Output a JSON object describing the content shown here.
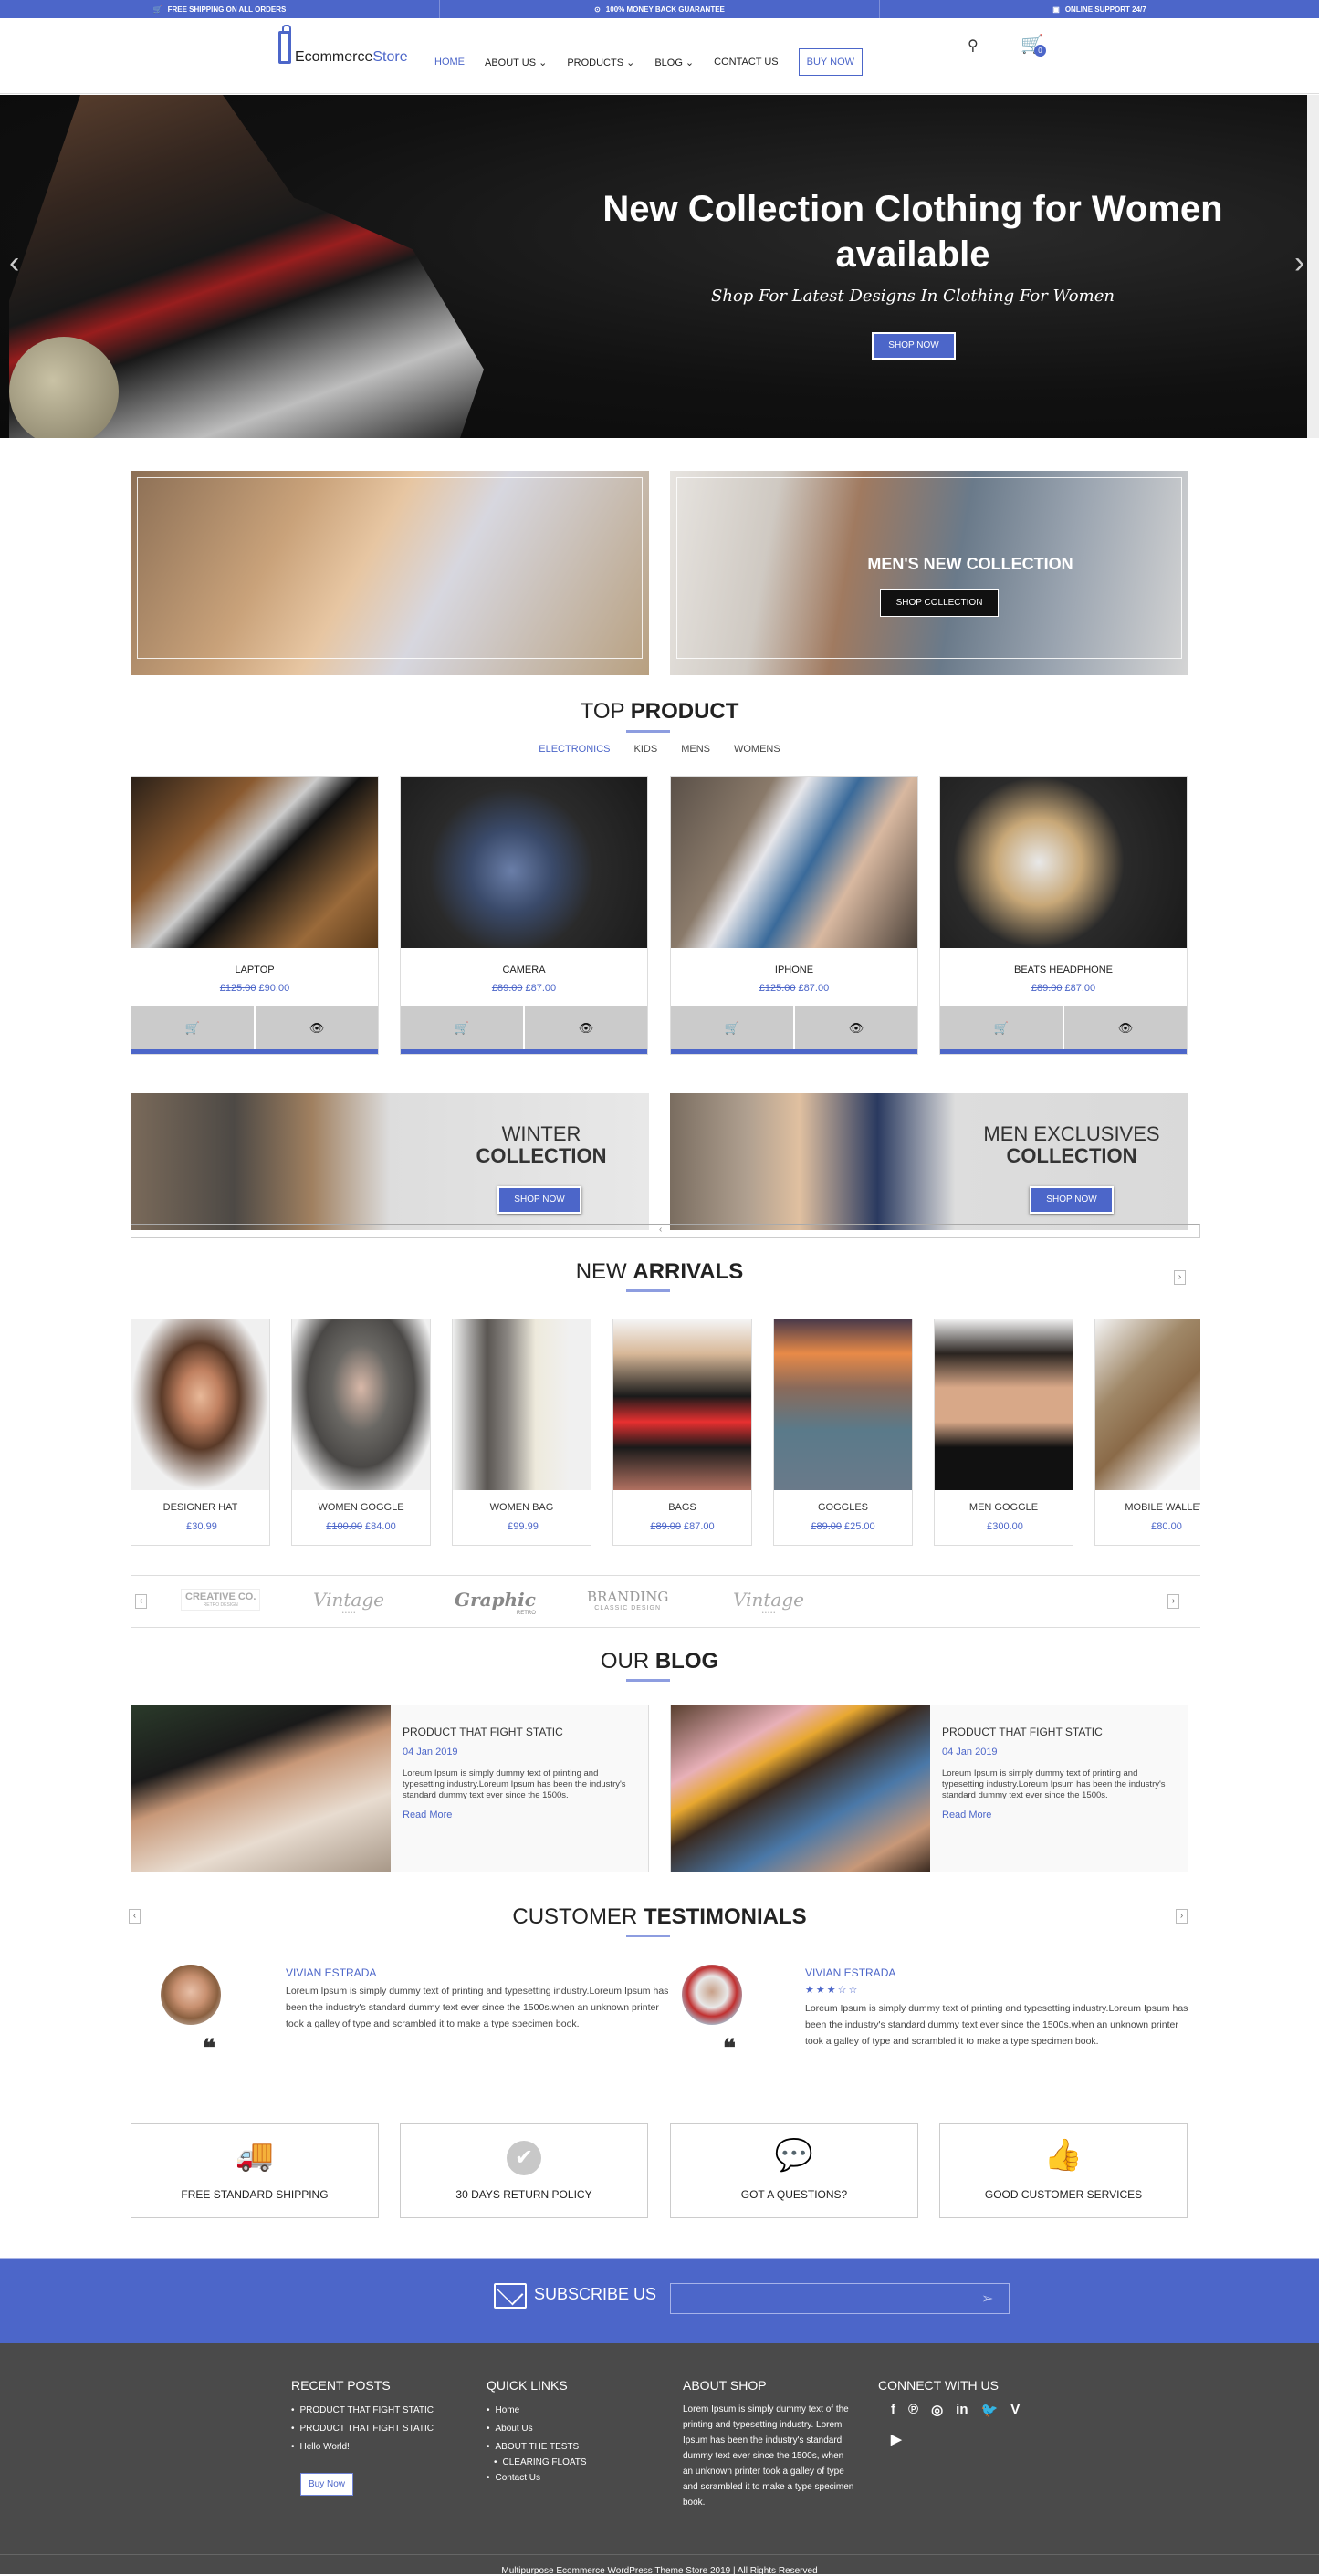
{
  "topbar": {
    "items": [
      {
        "icon": "cart-icon",
        "glyph": "🛒",
        "label": "FREE SHIPPING ON ALL ORDERS"
      },
      {
        "icon": "money-icon",
        "glyph": "⊙",
        "label": "100% MONEY BACK GUARANTEE"
      },
      {
        "icon": "support-icon",
        "glyph": "▣",
        "label": "ONLINE SUPPORT 24/7"
      }
    ]
  },
  "header": {
    "logo_text_1": "Ecommerce",
    "logo_text_2": "Store",
    "nav": {
      "home": "HOME",
      "about": "ABOUT US ⌄",
      "products": "PRODUCTS ⌄",
      "blog": "BLOG ⌄",
      "contact": "CONTACT US",
      "buy": "BUY NOW"
    },
    "cart_count": "0"
  },
  "hero": {
    "title": "New Collection Clothing for Women available",
    "subtitle": "Shop For Latest Designs In Clothing For Women",
    "button": "SHOP NOW",
    "prev": "‹",
    "next": "›"
  },
  "promo": {
    "mens_title": "MEN'S NEW COLLECTION",
    "mens_button": "SHOP COLLECTION"
  },
  "top_product": {
    "title_light": "TOP ",
    "title_bold": "PRODUCT",
    "tabs": [
      "ELECTRONICS",
      "KIDS",
      "MENS",
      "WOMENS"
    ],
    "products": [
      {
        "name": "LAPTOP",
        "old_price": "£125.00",
        "price": "£90.00"
      },
      {
        "name": "CAMERA",
        "old_price": "£89.00",
        "price": "£87.00"
      },
      {
        "name": "IPHONE",
        "old_price": "£125.00",
        "price": "£87.00"
      },
      {
        "name": "BEATS HEADPHONE",
        "old_price": "£89.00",
        "price": "£87.00"
      }
    ],
    "cart_glyph": "🛒",
    "view_glyph": "👁"
  },
  "collections": {
    "winter_line1": "WINTER",
    "winter_line2": "COLLECTION",
    "men_line1": "MEN EXCLUSIVES",
    "men_line2": "COLLECTION",
    "button": "SHOP NOW",
    "slider_arrow": "‹"
  },
  "new_arrivals": {
    "title_light": "NEW ",
    "title_bold": "ARRIVALS",
    "next": "›",
    "items": [
      {
        "name": "DESIGNER HAT",
        "old_price": "",
        "price": "£30.99"
      },
      {
        "name": "WOMEN GOGGLE",
        "old_price": "£100.00",
        "price": "£84.00"
      },
      {
        "name": "WOMEN BAG",
        "old_price": "",
        "price": "£99.99"
      },
      {
        "name": "BAGS",
        "old_price": "£89.00",
        "price": "£87.00"
      },
      {
        "name": "GOGGLES",
        "old_price": "£89.00",
        "price": "£25.00"
      },
      {
        "name": "MEN GOGGLE",
        "old_price": "",
        "price": "£300.00"
      },
      {
        "name": "MOBILE WALLET",
        "old_price": "",
        "price": "£80.00"
      }
    ]
  },
  "brands": {
    "prev": "‹",
    "next": "›",
    "logos": [
      {
        "main": "CREATIVE CO.",
        "sub": "RETRO DESIGN"
      },
      {
        "main": "Vintage",
        "sub": "• • • • •"
      },
      {
        "main": "Graphic",
        "sub": "RETRO"
      },
      {
        "main": "BRANDING",
        "sub": "CLASSIC DESIGN"
      },
      {
        "main": "Vintage",
        "sub": "• • • • •"
      }
    ]
  },
  "blog": {
    "title_light": "OUR ",
    "title_bold": "BLOG",
    "posts": [
      {
        "title": "PRODUCT THAT FIGHT STATIC",
        "date": "04 Jan 2019",
        "excerpt": "Loreum Ipsum is simply dummy text of printing and typesetting industry.Loreum Ipsum has been the industry's standard dummy text ever since the 1500s.",
        "read_more": "Read More"
      },
      {
        "title": "PRODUCT THAT FIGHT STATIC",
        "date": "04 Jan 2019",
        "excerpt": "Loreum Ipsum is simply dummy text of printing and typesetting industry.Loreum Ipsum has been the industry's standard dummy text ever since the 1500s.",
        "read_more": "Read More"
      }
    ]
  },
  "testimonials": {
    "title_light": "CUSTOMER ",
    "title_bold": "TESTIMONIALS",
    "prev": "‹",
    "next": "›",
    "items": [
      {
        "name": "VIVIAN ESTRADA",
        "rating": null,
        "text": "Loreum Ipsum is simply dummy text of printing and typesetting industry.Loreum Ipsum has been the industry's standard dummy text ever since the 1500s.when an unknown printer took a galley of type and scrambled it to make a type specimen book."
      },
      {
        "name": "VIVIAN ESTRADA",
        "rating": 3,
        "rating_max": 5,
        "stars": "★★★☆☆",
        "text": "Loreum Ipsum is simply dummy text of printing and typesetting industry.Loreum Ipsum has been the industry's standard dummy text ever since the 1500s.when an unknown printer took a galley of type and scrambled it to make a type specimen book."
      }
    ],
    "quote_glyph": "❝"
  },
  "features": [
    {
      "icon": "truck-icon",
      "glyph": "🚚",
      "label": "FREE STANDARD SHIPPING"
    },
    {
      "icon": "check-circle-icon",
      "glyph": "✔",
      "label": "30 DAYS RETURN POLICY"
    },
    {
      "icon": "chat-icon",
      "glyph": "💬",
      "label": "GOT A QUESTIONS?"
    },
    {
      "icon": "thumbs-up-icon",
      "glyph": "👍",
      "label": "GOOD CUSTOMER SERVICES"
    }
  ],
  "subscribe": {
    "label": "SUBSCRIBE US",
    "placeholder": "",
    "send_glyph": "➢"
  },
  "footer": {
    "recent_posts": {
      "heading": "RECENT POSTS",
      "items": [
        "PRODUCT THAT FIGHT STATIC",
        "PRODUCT THAT FIGHT STATIC",
        "Hello World!"
      ],
      "buy_button": "Buy Now"
    },
    "quick_links": {
      "heading": "QUICK LINKS",
      "items": [
        "Home",
        "About Us",
        "ABOUT THE TESTS",
        "CLEARING FLOATS",
        "Contact Us"
      ]
    },
    "about": {
      "heading": "ABOUT SHOP",
      "text": "Lorem Ipsum is simply dummy text of the printing and typesetting industry. Lorem Ipsum has been the industry's standard dummy text ever since the 1500s, when an unknown printer took a galley of type and scrambled it to make a type specimen book."
    },
    "connect": {
      "heading": "CONNECT WITH US",
      "social": [
        {
          "icon": "facebook-icon",
          "glyph": "f"
        },
        {
          "icon": "pinterest-icon",
          "glyph": "℗"
        },
        {
          "icon": "instagram-icon",
          "glyph": "◎"
        },
        {
          "icon": "linkedin-icon",
          "glyph": "in"
        },
        {
          "icon": "twitter-icon",
          "glyph": "🐦"
        },
        {
          "icon": "vimeo-icon",
          "glyph": "V"
        },
        {
          "icon": "youtube-icon",
          "glyph": "▶"
        }
      ]
    },
    "copyright": "Multipurpose Ecommerce WordPress Theme Store 2019 | All Rights Reserved"
  },
  "colors": {
    "accent": "#4c66c9",
    "footer_bg": "#4a4a4a"
  }
}
